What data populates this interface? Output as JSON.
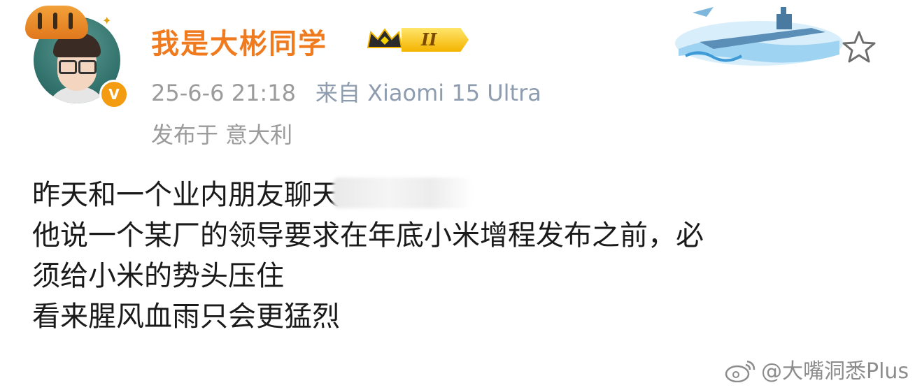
{
  "post": {
    "username": "我是大彬同学",
    "member_level": "II",
    "timestamp": "25-6-6 21:18",
    "source": "来自 Xiaomi 15 Ultra",
    "location": "发布于 意大利",
    "content_lines": [
      "昨天和一个业内朋友聊天",
      "他说一个某厂的领导要求在年底小米增程发布之前，必",
      "须给小米的势头压住",
      "看来腥风血雨只会更猛烈"
    ]
  },
  "watermark": "@大嘴洞悉Plus",
  "icons": {
    "avatar": "avatar-memoji-icon",
    "verified": "verified-v-icon",
    "crown": "crown-icon",
    "favorite": "star-outline-icon",
    "banner": "aircraft-carrier-banner-icon",
    "weibo": "weibo-logo-icon"
  },
  "colors": {
    "username": "#f07a1e",
    "meta_text": "#9b9b9b",
    "device_text": "#8e9caf",
    "body_text": "#1a1a1a",
    "verified_badge": "#f39c12",
    "level_badge": "#f4b400"
  }
}
